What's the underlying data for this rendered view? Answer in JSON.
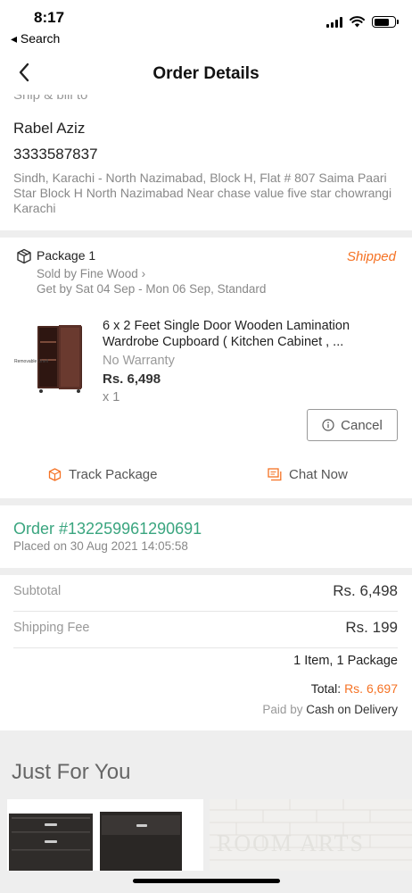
{
  "status_bar": {
    "time": "8:17",
    "back_app": "◂ Search",
    "icons": [
      "cellular-signal-icon",
      "wifi-icon",
      "battery-icon"
    ]
  },
  "nav": {
    "back_icon": "chevron-left-icon",
    "title": "Order Details"
  },
  "shipping": {
    "heading": "Ship & bill to",
    "name": "Rabel Aziz",
    "phone": "3333587837",
    "address": "Sindh, Karachi - North Nazimabad, Block H, Flat # 807 Saima Paari Star Block H North Nazimabad Near chase value five star chowrangi Karachi"
  },
  "package": {
    "icon": "package-box-icon",
    "title": "Package 1",
    "status": "Shipped",
    "seller": "Sold by Fine Wood ›",
    "delivery": "Get by Sat 04 Sep - Mon 06 Sep, Standard",
    "product": {
      "image_caption": "Removable Shelf",
      "name": "6 x 2 Feet Single Door Wooden Lamination Wardrobe Cupboard ( Kitchen Cabinet , ...",
      "warranty": "No Warranty",
      "price": "Rs. 6,498",
      "quantity": "x 1"
    },
    "cancel_label": "Cancel",
    "track_label": "Track Package",
    "chat_label": "Chat Now"
  },
  "order": {
    "number": "Order #132259961290691",
    "placed": "Placed on 30 Aug 2021  14:05:58"
  },
  "summary": {
    "subtotal_label": "Subtotal",
    "subtotal_value": "Rs. 6,498",
    "shipping_label": "Shipping Fee",
    "shipping_value": "Rs. 199",
    "items_count": "1 Item, 1 Package",
    "total_label": "Total: ",
    "total_value": "Rs. 6,697",
    "paid_label": "Paid by ",
    "paid_method": "Cash on Delivery"
  },
  "just_for_you": {
    "title": "Just For You",
    "thumb2_watermark": "ROOM ARTS"
  },
  "colors": {
    "accent_orange": "#f57224",
    "order_green": "#3aa57f",
    "divider": "#eeeeee"
  }
}
